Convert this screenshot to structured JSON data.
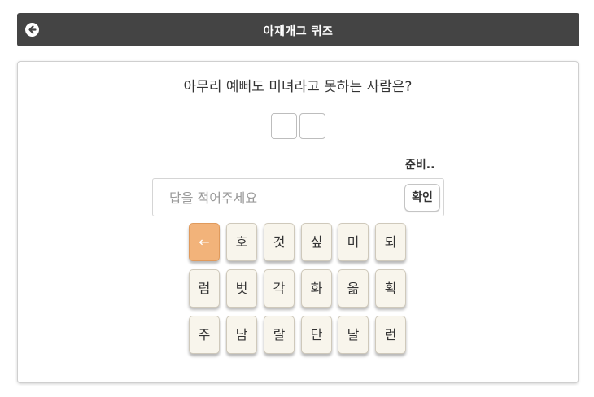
{
  "header": {
    "title": "아재개그 퀴즈",
    "back_icon": "arrow-left-circle-icon"
  },
  "quiz": {
    "question": "아무리 예뻐도 미녀라고 못하는 사람은?",
    "answer_length": 2,
    "status": "준비..",
    "input": {
      "value": "",
      "placeholder": "답을 적어주세요"
    },
    "confirm_label": "확인"
  },
  "keyboard": {
    "backspace_label": "←",
    "rows": [
      [
        "호",
        "것",
        "싶",
        "미",
        "되"
      ],
      [
        "럼",
        "벗",
        "각",
        "화",
        "옮",
        "획"
      ],
      [
        "주",
        "남",
        "랄",
        "단",
        "날",
        "런"
      ]
    ]
  },
  "colors": {
    "header_bg": "#444444",
    "key_bg": "#f8f5ec",
    "backspace_bg": "#f2b37a"
  }
}
